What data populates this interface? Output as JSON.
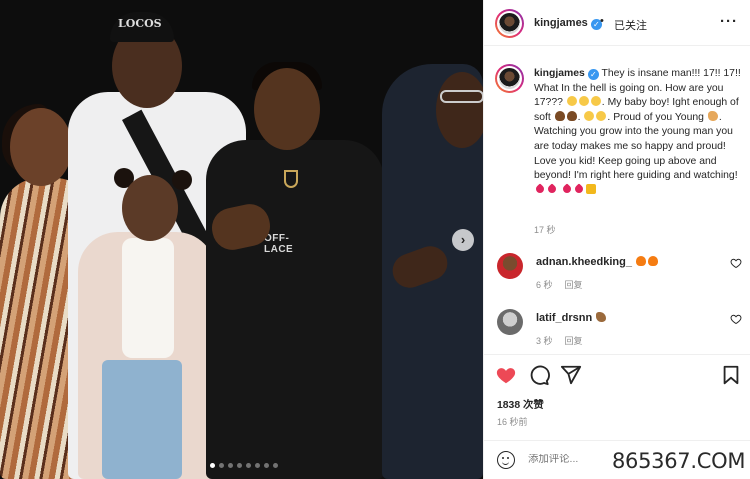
{
  "post": {
    "photo": {
      "cap_text": "LOCOS",
      "hoodie_print": "OFF-LACE"
    },
    "carousel": {
      "dot_count": 8,
      "active_index": 0,
      "next_symbol": "›"
    }
  },
  "header": {
    "username": "kingjames",
    "verified_symbol": "✓",
    "separator": "•",
    "follow_status": "已关注",
    "more_symbol": "···"
  },
  "caption": {
    "username": "kingjames",
    "p1": "They is insane man!!! 17!! 17!! What In the hell is going on. How are you 17???",
    "p2": "My baby boy! Ight enough of soft",
    "p3": "Proud of you Young",
    "p4": "Watching you grow into the young man you are today makes me so happy and proud! Love you kid! Keep going up above and beyond! I'm right here guiding and watching!",
    "time": "17 秒"
  },
  "comments": [
    {
      "username": "adnan.kheedking_",
      "time": "6 秒",
      "reply": "回复"
    },
    {
      "username": "latif_drsnn",
      "time": "3 秒",
      "reply": "回复"
    }
  ],
  "actions": {
    "likes": "1838 次赞",
    "timestamp": "16 秒前"
  },
  "add_comment": {
    "placeholder": "添加评论...",
    "watermark": "865367.COM"
  },
  "colors": {
    "like_red": "#ed4956",
    "verified_blue": "#3897f0",
    "meta_gray": "#8e8e8e"
  }
}
